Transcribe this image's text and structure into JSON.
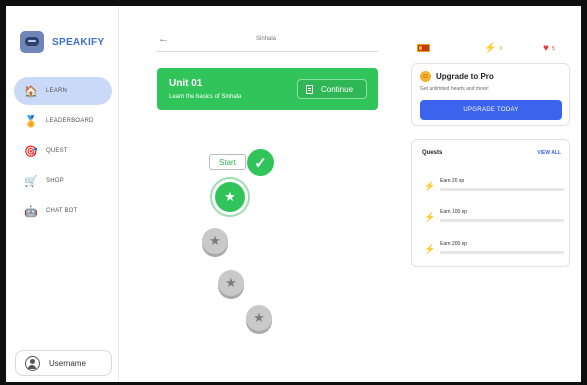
{
  "brand": {
    "name": "SPEAKIFY"
  },
  "sidebar": {
    "items": [
      {
        "label": "LEARN",
        "icon": "house-icon",
        "active": true
      },
      {
        "label": "LEADERBOARD",
        "icon": "medal-icon",
        "active": false
      },
      {
        "label": "QUEST",
        "icon": "target-icon",
        "active": false
      },
      {
        "label": "SHOP",
        "icon": "cart-icon",
        "active": false
      },
      {
        "label": "CHAT BOT",
        "icon": "robot-icon",
        "active": false
      }
    ]
  },
  "user": {
    "name": "Username"
  },
  "header": {
    "back": "←",
    "title": "Sinhala"
  },
  "unit": {
    "title": "Unit 01",
    "subtitle": "Learn the basics of Sinhala",
    "continue_label": "Continue"
  },
  "path": {
    "start_label": "Start",
    "lessons": [
      {
        "state": "completed"
      },
      {
        "state": "active"
      },
      {
        "state": "locked"
      },
      {
        "state": "locked"
      },
      {
        "state": "locked"
      }
    ]
  },
  "stats": {
    "flag": "sri-lanka-flag",
    "gems": "0",
    "hearts": "5"
  },
  "upgrade": {
    "title": "Upgrade to Pro",
    "subtitle": "Get unlimited hearts and more!",
    "button_label": "UPGRADE TODAY"
  },
  "quests": {
    "title": "Quests",
    "view_all": "VIEW ALL",
    "items": [
      {
        "label": "Earn 20 xp",
        "progress": 0
      },
      {
        "label": "Earn 100 xp",
        "progress": 0
      },
      {
        "label": "Earn 200 xp",
        "progress": 0
      }
    ]
  },
  "colors": {
    "brand_blue": "#3d6fd1",
    "primary_green": "#31c45a",
    "accent_blue": "#3b63ee",
    "gold": "#f2b61b",
    "heart_red": "#e23b3b"
  }
}
